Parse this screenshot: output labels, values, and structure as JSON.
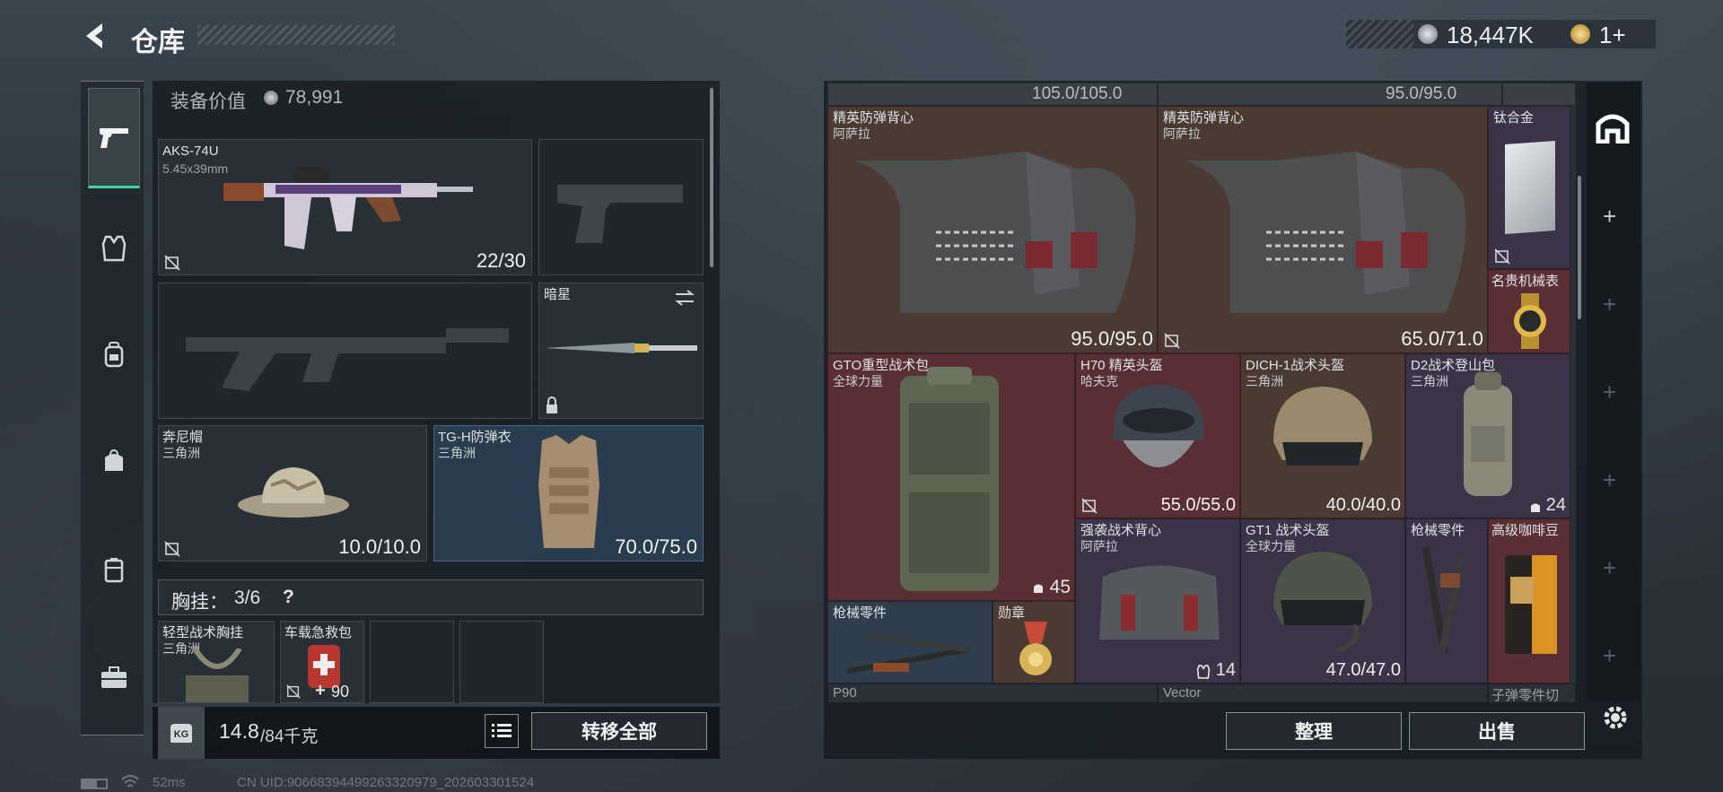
{
  "header": {
    "title": "仓库"
  },
  "currency": {
    "silver": "18,447K",
    "gold": "1+"
  },
  "equipment": {
    "value_label": "装备价值",
    "value": "78,991",
    "primary": {
      "name": "AKS-74U",
      "ammo": "5.45x39mm",
      "count": "22/30"
    },
    "melee": {
      "name": "暗星"
    },
    "helmet": {
      "name": "奔尼帽",
      "origin": "三角洲",
      "durability": "10.0/10.0"
    },
    "armor": {
      "name": "TG-H防弹衣",
      "origin": "三角洲",
      "durability": "70.0/75.0"
    },
    "chest_rig": {
      "label": "胸挂：",
      "value": "3/6",
      "help": "?"
    },
    "rig_items": [
      {
        "name": "轻型战术胸挂",
        "origin": "三角洲"
      },
      {
        "name": "车载急救包",
        "count": "90"
      }
    ],
    "weight": {
      "value": "14.8",
      "max": "/84千克",
      "icon": "KG"
    },
    "transfer_label": "转移全部"
  },
  "storage": {
    "top_values": [
      "105.0/105.0",
      "95.0/95.0"
    ],
    "items": [
      {
        "name": "精英防弹背心",
        "origin": "阿萨拉",
        "durability": "95.0/95.0"
      },
      {
        "name": "精英防弹背心",
        "origin": "阿萨拉",
        "durability": "65.0/71.0"
      },
      {
        "name": "钛合金"
      },
      {
        "name": "名贵机械表"
      },
      {
        "name": "GTO重型战术包",
        "origin": "全球力量",
        "count": "45"
      },
      {
        "name": "H70 精英头盔",
        "origin": "哈夫克",
        "durability": "55.0/55.0"
      },
      {
        "name": "DICH-1战术头盔",
        "origin": "三角洲",
        "durability": "40.0/40.0"
      },
      {
        "name": "D2战术登山包",
        "origin": "三角洲",
        "count": "24"
      },
      {
        "name": "强袭战术背心",
        "origin": "阿萨拉",
        "count": "14"
      },
      {
        "name": "GT1 战术头盔",
        "origin": "全球力量",
        "durability": "47.0/47.0"
      },
      {
        "name": "枪械零件"
      },
      {
        "name": "高级咖啡豆"
      },
      {
        "name": "枪械零件"
      },
      {
        "name": "勋章"
      }
    ],
    "bottom_labels": [
      "P90",
      "Vector",
      "子弹零件切"
    ],
    "sort_label": "整理",
    "sell_label": "出售"
  },
  "status": {
    "ping": "52ms",
    "uid": "CN UID:90668394499263320979_202603301524"
  }
}
